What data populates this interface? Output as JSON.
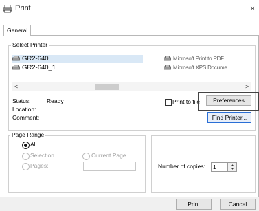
{
  "window": {
    "title": "Print",
    "close_glyph": "×"
  },
  "tabs": [
    {
      "label": "General"
    }
  ],
  "select_printer": {
    "group_label": "Select Printer",
    "printers": [
      {
        "name": "GR2-640",
        "selected": true
      },
      {
        "name": "GR2-640_1",
        "selected": false
      },
      {
        "name": "Microsoft Print to PDF",
        "selected": false
      },
      {
        "name": "Microsoft XPS Docume",
        "selected": false
      }
    ],
    "scroll_left": "<",
    "scroll_right": ">",
    "status_label": "Status:",
    "status_value": "Ready",
    "location_label": "Location:",
    "comment_label": "Comment:",
    "print_to_file_label": "Print to file",
    "preferences_button": "Preferences",
    "find_printer_button": "Find Printer..."
  },
  "page_range": {
    "group_label": "Page Range",
    "options": [
      {
        "label": "All",
        "checked": true,
        "enabled": true
      },
      {
        "label": "Selection",
        "checked": false,
        "enabled": false
      },
      {
        "label": "Current Page",
        "checked": false,
        "enabled": false
      },
      {
        "label": "Pages:",
        "checked": false,
        "enabled": false
      }
    ],
    "pages_value": ""
  },
  "copies": {
    "label": "Number of copies:",
    "value": "1"
  },
  "buttons": {
    "print": "Print",
    "cancel": "Cancel"
  },
  "icons": {
    "title": "printer-icon",
    "printer_item": "printer-icon",
    "spinner": "spin-arrows-icon"
  },
  "colors": {
    "selection_highlight": "#d9e8f6",
    "focus_border": "#2a6fd6"
  }
}
